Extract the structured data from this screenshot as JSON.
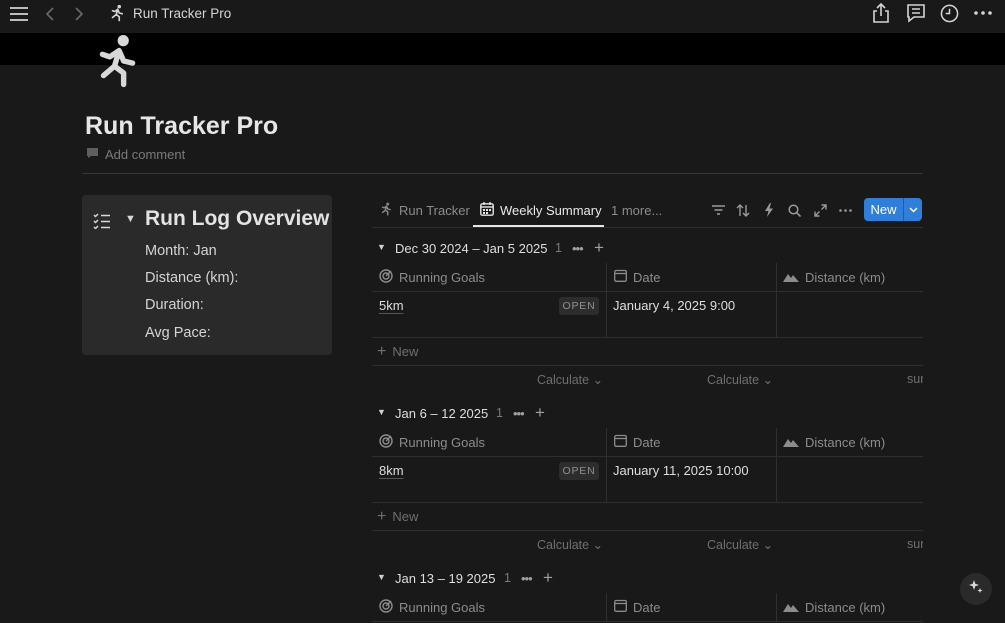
{
  "topbar": {
    "title": "Run Tracker Pro"
  },
  "page": {
    "title": "Run Tracker Pro",
    "add_comment": "Add comment"
  },
  "callout": {
    "title": "Run Log Overview",
    "lines": [
      "Month: Jan",
      "Distance (km):",
      "Duration:",
      "Avg Pace:"
    ]
  },
  "views": {
    "tabs": [
      {
        "label": "Run Tracker",
        "active": false
      },
      {
        "label": "Weekly Summary",
        "active": true
      }
    ],
    "more": "1 more...",
    "new_button": "New"
  },
  "columns": {
    "goal": "Running Goals",
    "date": "Date",
    "distance": "Distance (km)"
  },
  "groups": [
    {
      "title": "Dec 30 2024 – Jan 5 2025",
      "count": "1",
      "rows": [
        {
          "name": "5km",
          "status": "OPEN",
          "date": "January 4, 2025 9:00",
          "distance": ""
        }
      ]
    },
    {
      "title": "Jan 6 – 12 2025",
      "count": "1",
      "rows": [
        {
          "name": "8km",
          "status": "OPEN",
          "date": "January 11, 2025 10:00",
          "distance": ""
        }
      ]
    },
    {
      "title": "Jan 13 – 19 2025",
      "count": "1",
      "rows": []
    }
  ],
  "table": {
    "new_row": "New",
    "calculate": "Calculate",
    "sum_partial": "sur"
  },
  "colors": {
    "accent": "#2f7ed8",
    "background": "#191919",
    "callout_bg": "#2a2a2a"
  }
}
